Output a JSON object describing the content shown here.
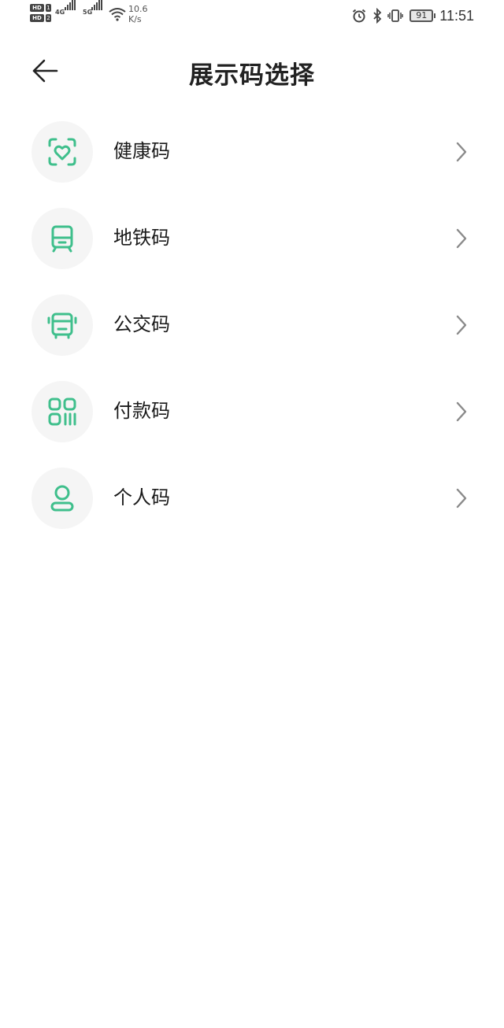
{
  "status_bar": {
    "hd1": "HD",
    "hd1_num": "1",
    "hd2": "HD",
    "hd2_num": "2",
    "net1": "4G",
    "net2": "5G",
    "speed_value": "10.6",
    "speed_unit": "K/s",
    "battery": "91",
    "time": "11:51"
  },
  "header": {
    "title": "展示码选择"
  },
  "items": [
    {
      "label": "健康码",
      "icon": "heart-scan-icon"
    },
    {
      "label": "地铁码",
      "icon": "subway-icon"
    },
    {
      "label": "公交码",
      "icon": "bus-icon"
    },
    {
      "label": "付款码",
      "icon": "payment-code-icon"
    },
    {
      "label": "个人码",
      "icon": "person-icon"
    }
  ],
  "colors": {
    "accent": "#3fbf8c",
    "icon_bg": "#f5f5f5",
    "text": "#1a1a1a",
    "chevron": "#8a8a8a"
  }
}
